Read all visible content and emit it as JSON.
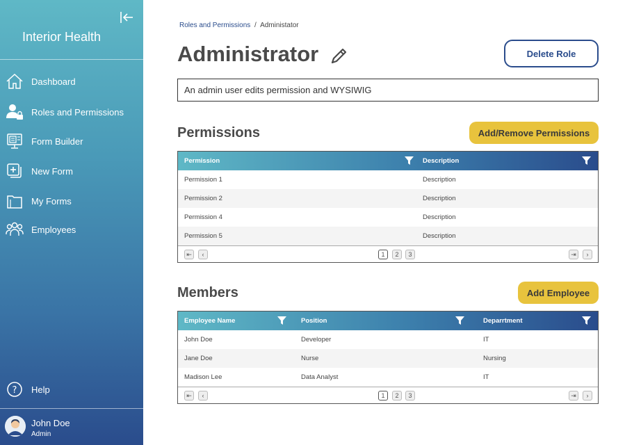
{
  "sidebar": {
    "app_title": "Interior Health",
    "items": [
      {
        "label": "Dashboard"
      },
      {
        "label": "Roles and Permissions"
      },
      {
        "label": "Form Builder"
      },
      {
        "label": "New Form"
      },
      {
        "label": "My Forms"
      },
      {
        "label": "Employees"
      }
    ],
    "help_label": "Help",
    "user": {
      "name": "John Doe",
      "role": "Admin"
    }
  },
  "breadcrumb": {
    "parent": "Roles and Permissions",
    "separator": "/",
    "current": "Administator"
  },
  "page": {
    "title": "Administrator",
    "delete_label": "Delete Role",
    "description_value": "An admin user edits permission and WYSIWIG"
  },
  "permissions": {
    "section_title": "Permissions",
    "button_label": "Add/Remove Permissions",
    "columns": [
      "Permission",
      "Description"
    ],
    "rows": [
      [
        "Permission 1",
        "Description"
      ],
      [
        "Permission 2",
        "Description"
      ],
      [
        "Permission 4",
        "Description"
      ],
      [
        "Permission 5",
        "Description"
      ]
    ],
    "pages": [
      "1",
      "2",
      "3"
    ],
    "active_page": "1"
  },
  "members": {
    "section_title": "Members",
    "button_label": "Add Employee",
    "columns": [
      "Employee Name",
      "Position",
      "Deparrtment"
    ],
    "rows": [
      [
        "John Doe",
        "Developer",
        "IT"
      ],
      [
        "Jane Doe",
        "Nurse",
        "Nursing"
      ],
      [
        "Madison Lee",
        "Data Analyst",
        "IT"
      ]
    ],
    "pages": [
      "1",
      "2",
      "3"
    ],
    "active_page": "1"
  },
  "colors": {
    "accent_dark": "#2a4c8c",
    "accent_light": "#5fb8c6",
    "button_yellow": "#e8c33d"
  },
  "icons": {
    "collapse": "collapse-sidebar-icon",
    "dashboard": "home-icon",
    "roles": "user-lock-icon",
    "form_builder": "monitor-form-icon",
    "new_form": "add-document-icon",
    "my_forms": "folder-icon",
    "employees": "users-group-icon",
    "help": "help-circle-icon",
    "edit": "pencil-icon",
    "filter": "filter-icon"
  }
}
